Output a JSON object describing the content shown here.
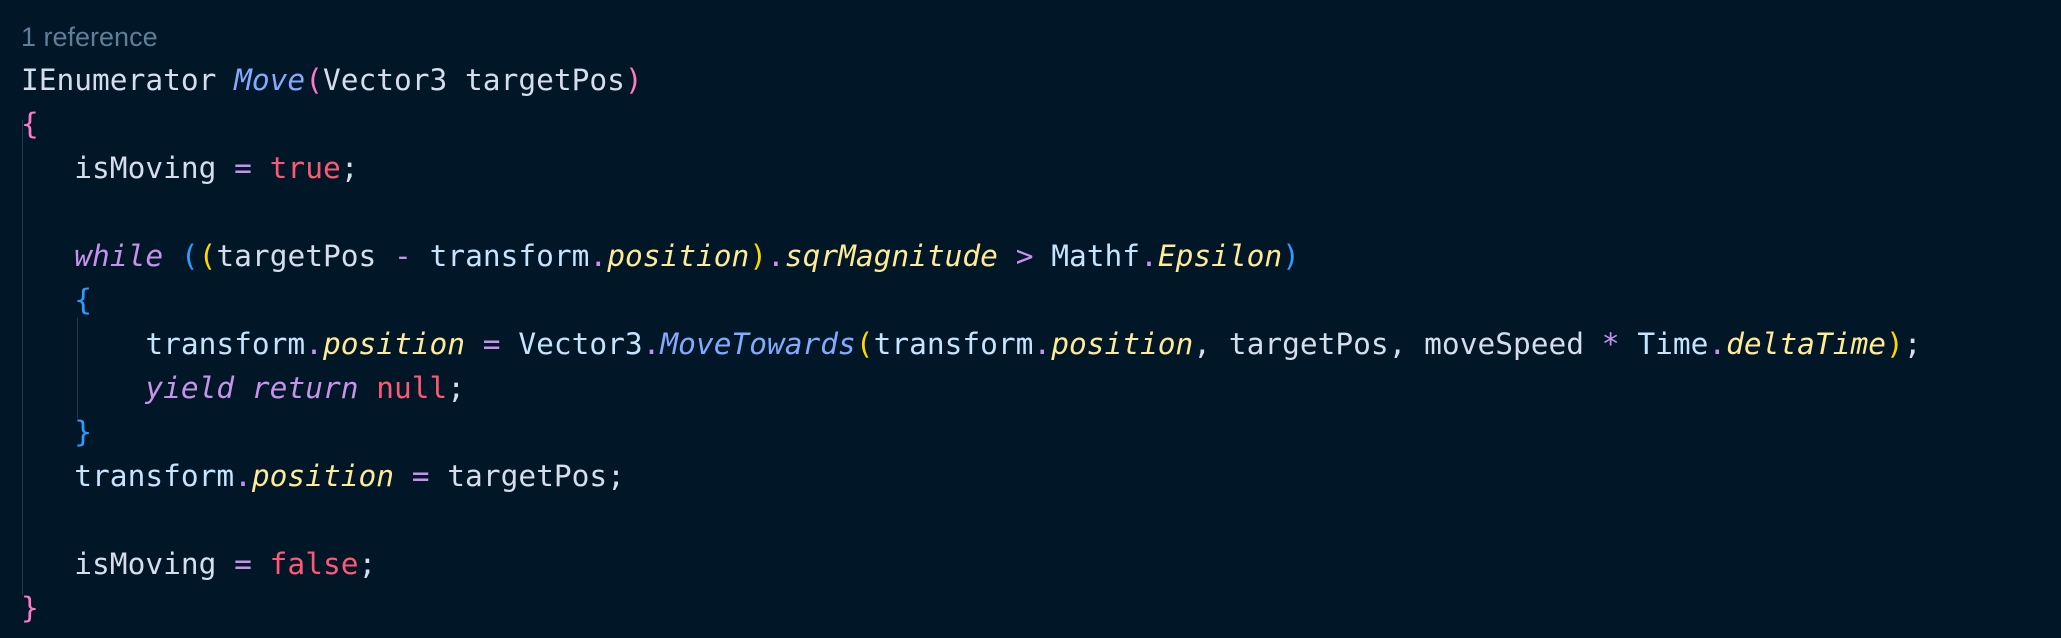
{
  "codelens": {
    "text": "1 reference"
  },
  "colors": {
    "background": "#011627",
    "text": "#d6deeb",
    "keyword": "#c792ea",
    "function": "#82aaff",
    "property": "#ffeb95",
    "boolean": "#ff5874",
    "bracket_pink": "#ff79c6",
    "bracket_yellow": "#ffd700",
    "bracket_blue": "#2f9bff",
    "codelens": "#5f7e97",
    "indent_guide": "#1d3b53"
  },
  "lines": [
    [
      {
        "t": "IEnumerator",
        "c": "type"
      },
      {
        "t": " ",
        "c": "plain"
      },
      {
        "t": "Move",
        "c": "func"
      },
      {
        "t": "(",
        "c": "b1"
      },
      {
        "t": "Vector3",
        "c": "type"
      },
      {
        "t": " targetPos",
        "c": "var"
      },
      {
        "t": ")",
        "c": "b1"
      }
    ],
    [
      {
        "t": "{",
        "c": "b1"
      }
    ],
    [
      {
        "t": "   isMoving",
        "c": "var"
      },
      {
        "t": " = ",
        "c": "op"
      },
      {
        "t": "true",
        "c": "bool"
      },
      {
        "t": ";",
        "c": "punc"
      }
    ],
    [],
    [
      {
        "t": "   ",
        "c": "plain"
      },
      {
        "t": "while",
        "c": "kw"
      },
      {
        "t": " ",
        "c": "plain"
      },
      {
        "t": "(",
        "c": "b3"
      },
      {
        "t": "(",
        "c": "b2"
      },
      {
        "t": "targetPos",
        "c": "var"
      },
      {
        "t": " - ",
        "c": "op"
      },
      {
        "t": "transform",
        "c": "obj"
      },
      {
        "t": ".",
        "c": "op"
      },
      {
        "t": "position",
        "c": "prop"
      },
      {
        "t": ")",
        "c": "b2"
      },
      {
        "t": ".",
        "c": "op"
      },
      {
        "t": "sqrMagnitude",
        "c": "prop"
      },
      {
        "t": " > ",
        "c": "op"
      },
      {
        "t": "Mathf",
        "c": "obj"
      },
      {
        "t": ".",
        "c": "op"
      },
      {
        "t": "Epsilon",
        "c": "prop"
      },
      {
        "t": ")",
        "c": "b3"
      }
    ],
    [
      {
        "t": "   ",
        "c": "plain"
      },
      {
        "t": "{",
        "c": "b3"
      }
    ],
    [
      {
        "t": "       transform",
        "c": "obj"
      },
      {
        "t": ".",
        "c": "op"
      },
      {
        "t": "position",
        "c": "prop"
      },
      {
        "t": " = ",
        "c": "op"
      },
      {
        "t": "Vector3",
        "c": "obj"
      },
      {
        "t": ".",
        "c": "op"
      },
      {
        "t": "MoveTowards",
        "c": "func"
      },
      {
        "t": "(",
        "c": "b2"
      },
      {
        "t": "transform",
        "c": "obj"
      },
      {
        "t": ".",
        "c": "op"
      },
      {
        "t": "position",
        "c": "prop"
      },
      {
        "t": ", targetPos, moveSpeed",
        "c": "var"
      },
      {
        "t": " * ",
        "c": "op"
      },
      {
        "t": "Time",
        "c": "obj"
      },
      {
        "t": ".",
        "c": "op"
      },
      {
        "t": "deltaTime",
        "c": "prop"
      },
      {
        "t": ")",
        "c": "b2"
      },
      {
        "t": ";",
        "c": "punc"
      }
    ],
    [
      {
        "t": "       ",
        "c": "plain"
      },
      {
        "t": "yield",
        "c": "kw"
      },
      {
        "t": " ",
        "c": "plain"
      },
      {
        "t": "return",
        "c": "kw"
      },
      {
        "t": " ",
        "c": "plain"
      },
      {
        "t": "null",
        "c": "bool"
      },
      {
        "t": ";",
        "c": "punc"
      }
    ],
    [
      {
        "t": "   ",
        "c": "plain"
      },
      {
        "t": "}",
        "c": "b3"
      }
    ],
    [
      {
        "t": "   transform",
        "c": "obj"
      },
      {
        "t": ".",
        "c": "op"
      },
      {
        "t": "position",
        "c": "prop"
      },
      {
        "t": " = ",
        "c": "op"
      },
      {
        "t": "targetPos",
        "c": "var"
      },
      {
        "t": ";",
        "c": "punc"
      }
    ],
    [],
    [
      {
        "t": "   isMoving",
        "c": "var"
      },
      {
        "t": " = ",
        "c": "op"
      },
      {
        "t": "false",
        "c": "bool"
      },
      {
        "t": ";",
        "c": "punc"
      }
    ],
    [
      {
        "t": "}",
        "c": "b1"
      }
    ]
  ]
}
